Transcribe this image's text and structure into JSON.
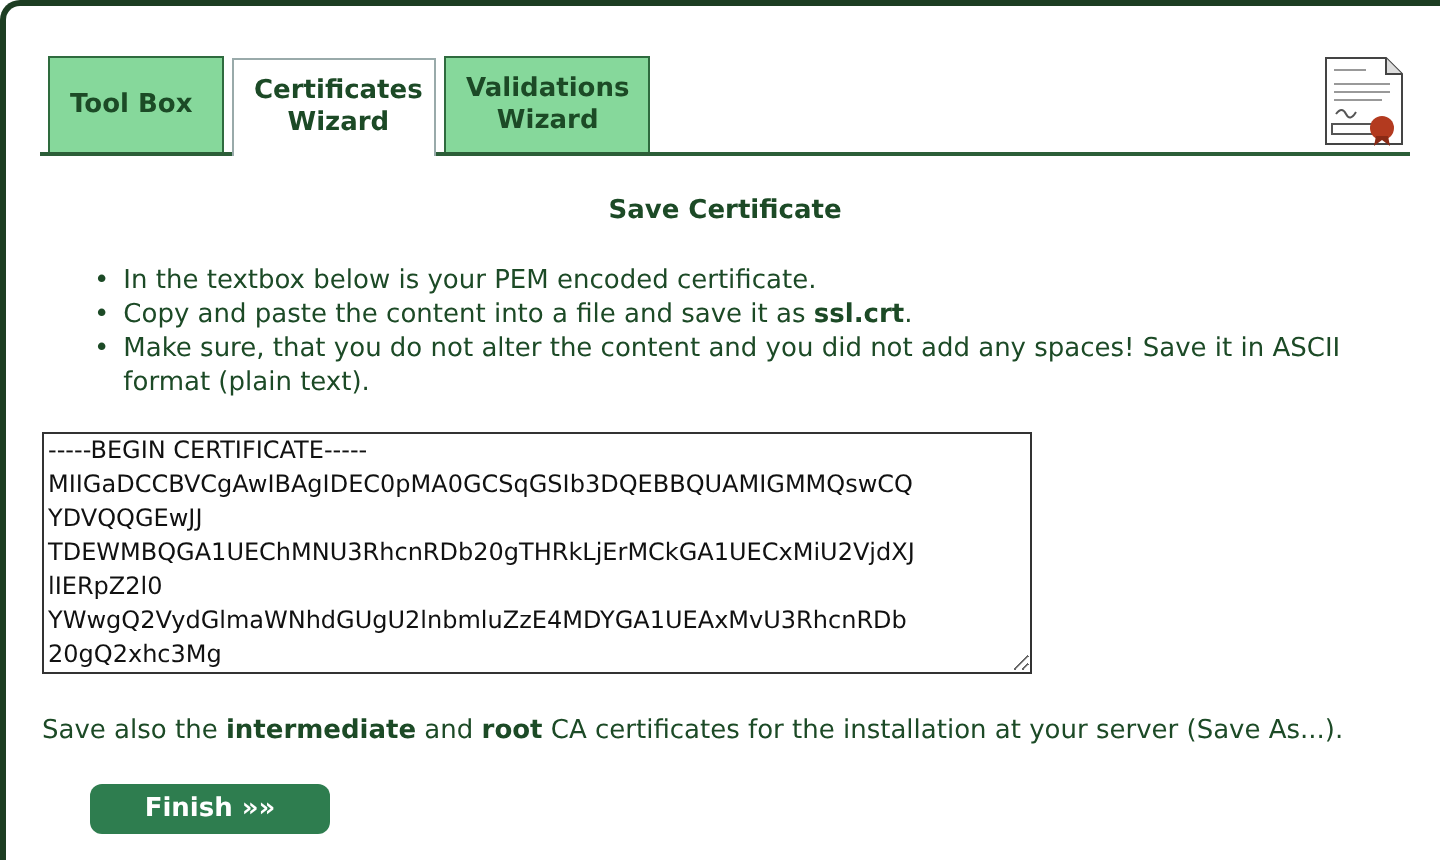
{
  "tabs": [
    {
      "label": "Tool Box",
      "selected": false
    },
    {
      "label": "Certificates Wizard",
      "selected": true
    },
    {
      "label": "Validations Wizard",
      "selected": false
    }
  ],
  "heading": "Save Certificate",
  "instructions": [
    {
      "bullet": "•",
      "text": "In the textbox below is your PEM encoded certificate."
    },
    {
      "bullet": "•",
      "text": "Copy and paste the content into a file and save it as **ssl.crt**."
    },
    {
      "bullet": "•",
      "text": "Make sure, that you do not alter the content and you did not add any spaces! Save it in ASCII format (plain text)."
    }
  ],
  "certificate_field": {
    "value": "-----BEGIN CERTIFICATE-----\nMIIGaDCCBVCgAwIBAgIDEC0pMA0GCSqGSIb3DQEBBQUAMIGMMQswCQ\nYDVQQGEwJJ\nTDEWMBQGA1UEChMNU3RhcnRDb20gTHRkLjErMCkGA1UECxMiU2VjdXJ\nlIERpZ2l0\nYWwgQ2VydGlmaWNhdGUgU2lnbmluZzE4MDYGA1UEAxMvU3RhcnRDb\n20gQ2xhc3Mg"
  },
  "note": "Save also the **intermediate** and **root** CA certificates for the installation at your server (Save As...).",
  "finish_button": "Finish »»"
}
